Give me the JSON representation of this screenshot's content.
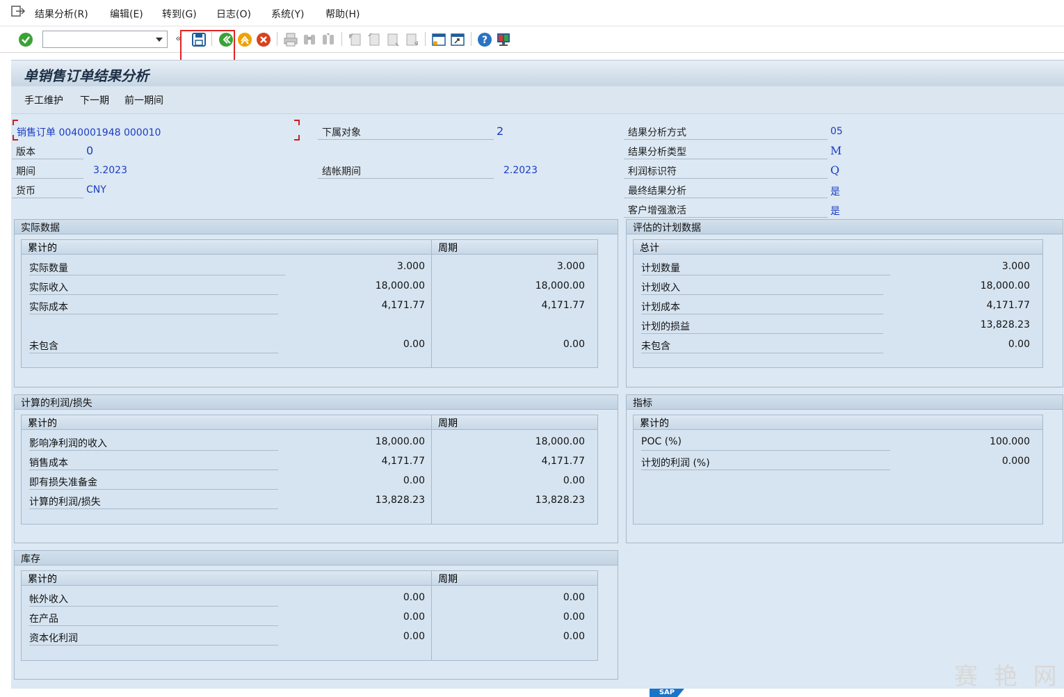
{
  "menubar": {
    "items": [
      "结果分析(R)",
      "编辑(E)",
      "转到(G)",
      "日志(O)",
      "系统(Y)",
      "帮助(H)"
    ]
  },
  "toolbar": {
    "command_value": "",
    "icons": [
      "check-icon",
      "save-icon",
      "back-icon",
      "exit-icon",
      "cancel-icon",
      "print-icon",
      "find-icon",
      "find-next-icon",
      "first-page-icon",
      "prev-page-icon",
      "next-page-icon",
      "last-page-icon",
      "new-session-icon",
      "shortcut-icon",
      "help-icon",
      "customize-icon"
    ]
  },
  "title": "单销售订单结果分析",
  "app_toolbar": {
    "buttons": [
      "手工维护",
      "下一期",
      "前一期间"
    ]
  },
  "header": {
    "sales_order_label": "销售订单 0040001948 000010",
    "version_label": "版本",
    "version_value": "0",
    "period_label": "期间",
    "period_value": "3.2023",
    "currency_label": "货币",
    "currency_value": "CNY",
    "sub_objects_label": "下属对象",
    "sub_objects_value": "2",
    "closing_period_label": "结帐期间",
    "closing_period_value": "2.2023",
    "ra_method_label": "结果分析方式",
    "ra_method_value": "05",
    "ra_type_label": "结果分析类型",
    "ra_type_value": "M",
    "profit_indicator_label": "利润标识符",
    "profit_indicator_value": "Q",
    "final_ra_label": "最终结果分析",
    "final_ra_value": "是",
    "customer_enh_label": "客户增强激活",
    "customer_enh_value": "是"
  },
  "actual": {
    "title": "实际数据",
    "col1": "累计的",
    "col2": "周期",
    "rows": [
      {
        "label": "实际数量",
        "cum": "3.000",
        "per": "3.000"
      },
      {
        "label": "实际收入",
        "cum": "18,000.00",
        "per": "18,000.00"
      },
      {
        "label": "实际成本",
        "cum": "4,171.77",
        "per": "4,171.77"
      },
      {
        "label": "未包含",
        "cum": "0.00",
        "per": "0.00"
      }
    ]
  },
  "planned": {
    "title": "评估的计划数据",
    "col1": "总计",
    "rows": [
      {
        "label": "计划数量",
        "val": "3.000"
      },
      {
        "label": "计划收入",
        "val": "18,000.00"
      },
      {
        "label": "计划成本",
        "val": "4,171.77"
      },
      {
        "label": "计划的损益",
        "val": "13,828.23"
      },
      {
        "label": "未包含",
        "val": "0.00"
      }
    ]
  },
  "calc": {
    "title": "计算的利润/损失",
    "col1": "累计的",
    "col2": "周期",
    "rows": [
      {
        "label": "影响净利润的收入",
        "cum": "18,000.00",
        "per": "18,000.00"
      },
      {
        "label": "销售成本",
        "cum": "4,171.77",
        "per": "4,171.77"
      },
      {
        "label": "即有损失准备金",
        "cum": "0.00",
        "per": "0.00"
      },
      {
        "label": "计算的利润/损失",
        "cum": "13,828.23",
        "per": "13,828.23"
      }
    ]
  },
  "indicators": {
    "title": "指标",
    "col1": "累计的",
    "rows": [
      {
        "label": "POC (%)",
        "val": "100.000"
      },
      {
        "label": "计划的利润 (%)",
        "val": "0.000"
      }
    ]
  },
  "inventory": {
    "title": "库存",
    "col1": "累计的",
    "col2": "周期",
    "rows": [
      {
        "label": "帐外收入",
        "cum": "0.00",
        "per": "0.00"
      },
      {
        "label": "在产品",
        "cum": "0.00",
        "per": "0.00"
      },
      {
        "label": "资本化利润",
        "cum": "0.00",
        "per": "0.00"
      }
    ]
  },
  "footer": {
    "watermark": "赛 艳 网",
    "sap_logo": "SAP"
  },
  "colors": {
    "value_blue": "#1a3cc4",
    "panel_bg": "#dce8f3",
    "highlight_red": "#e02424"
  }
}
